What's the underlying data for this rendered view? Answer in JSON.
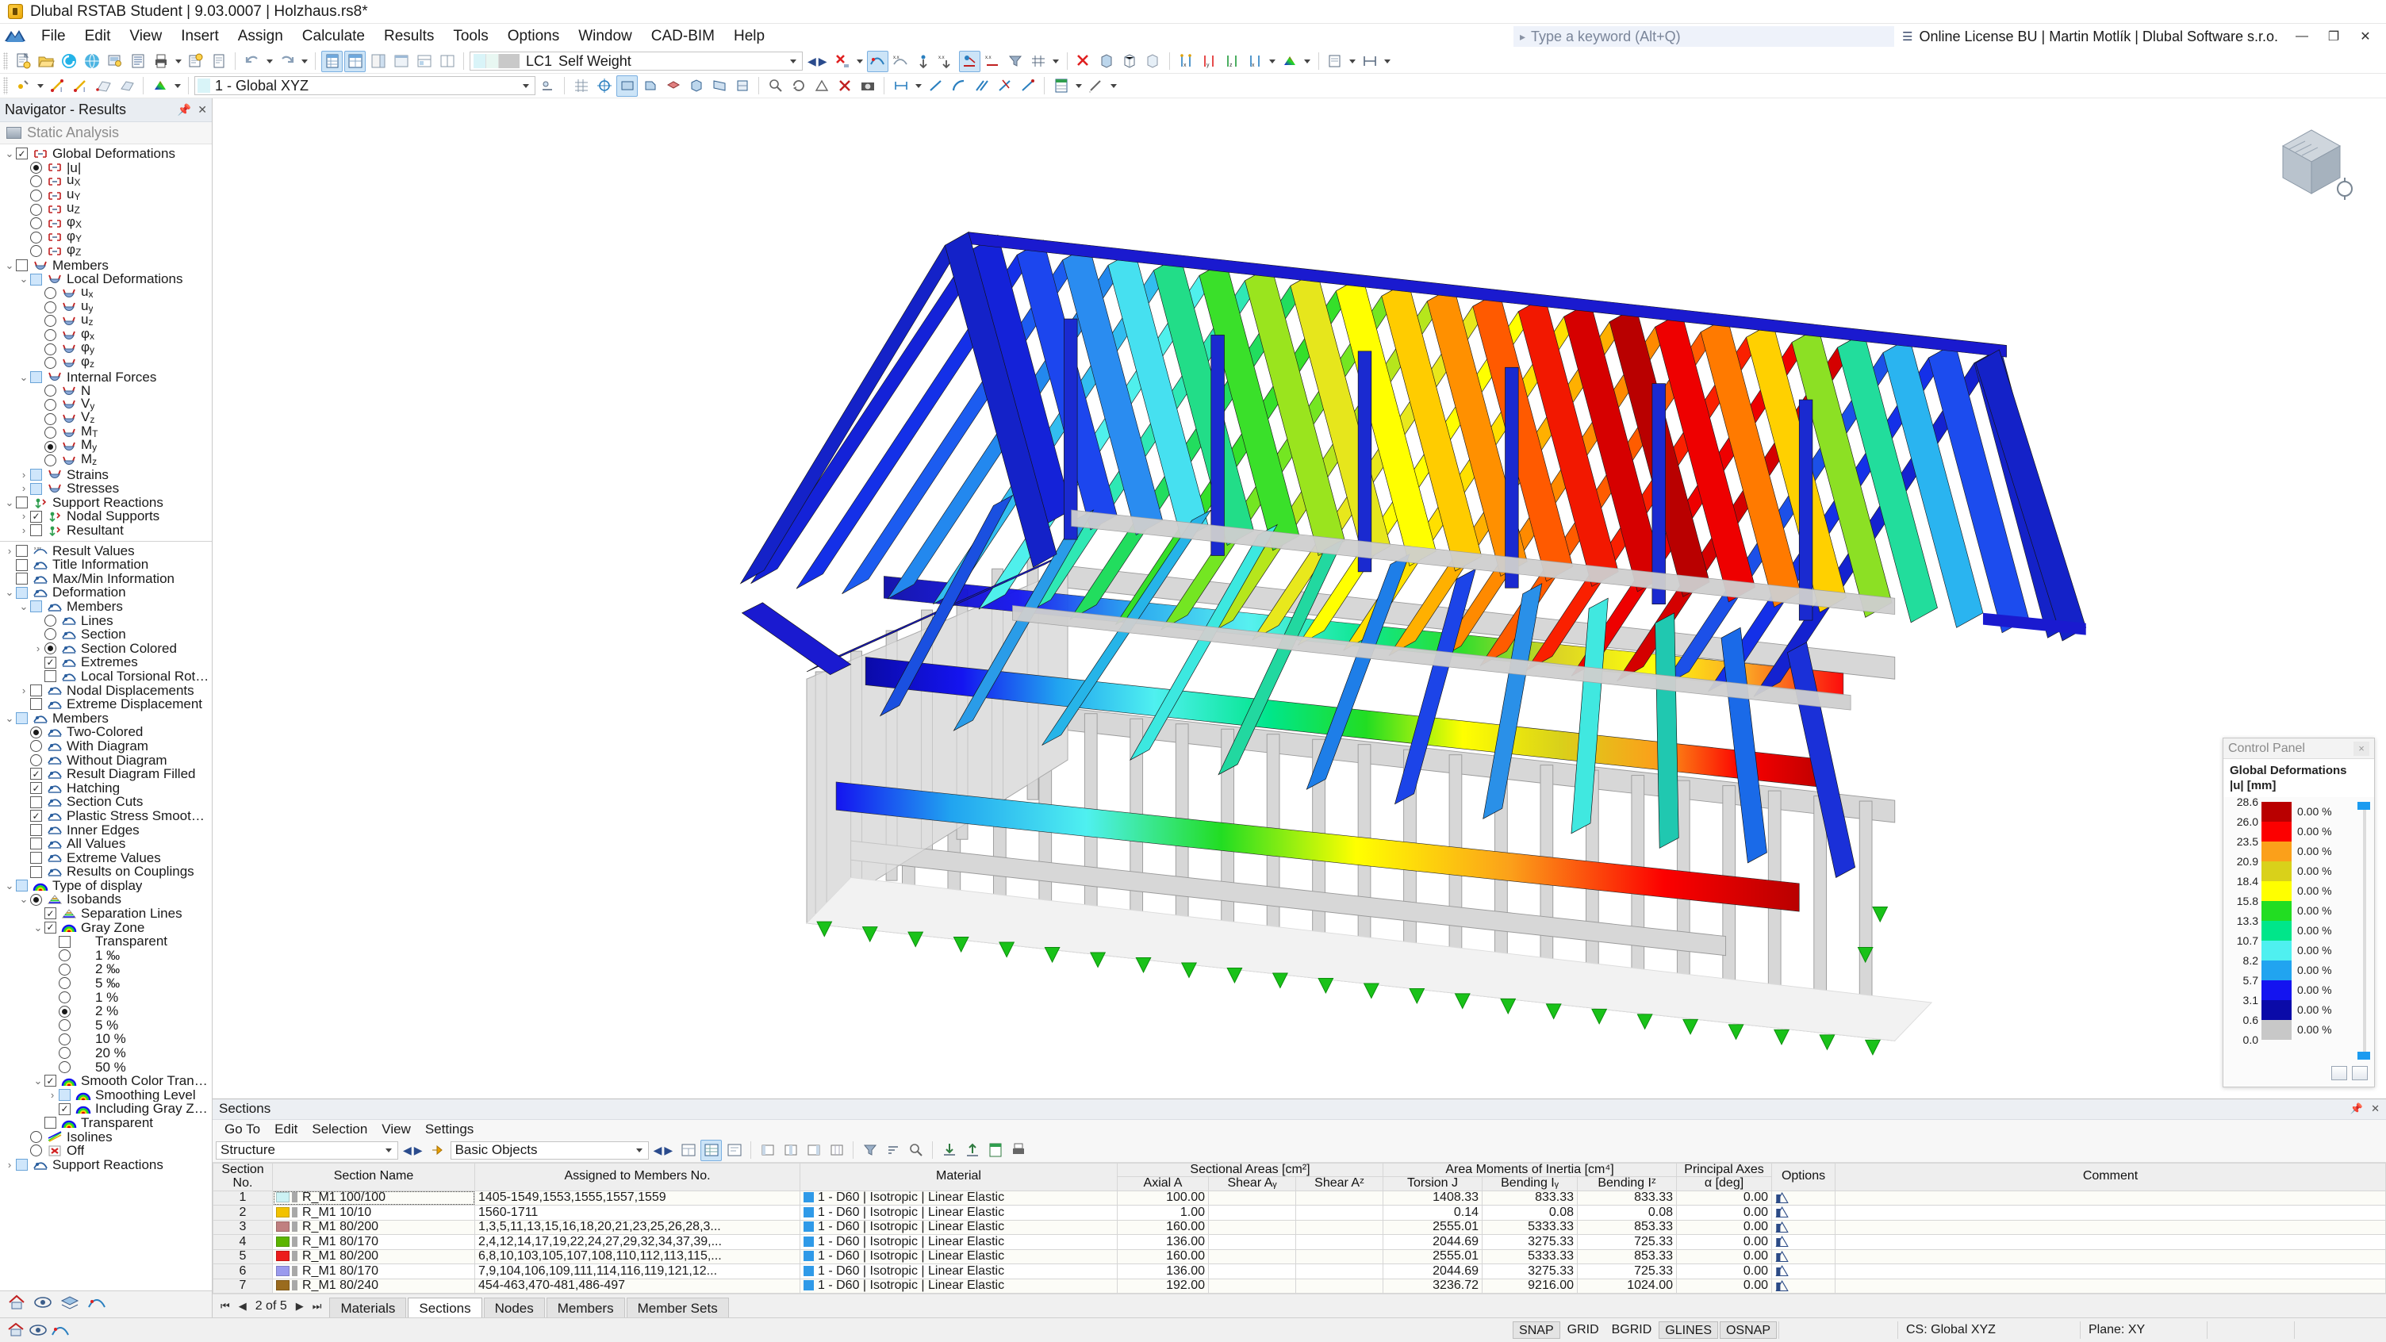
{
  "window": {
    "title": "Dlubal RSTAB Student | 9.03.0007 | Holzhaus.rs8*",
    "minimize": "—",
    "maximize": "❐",
    "close": "✕"
  },
  "menu": {
    "items": [
      "File",
      "Edit",
      "View",
      "Insert",
      "Assign",
      "Calculate",
      "Results",
      "Tools",
      "Options",
      "Window",
      "CAD-BIM",
      "Help"
    ],
    "search_placeholder": "Type a keyword (Alt+Q)",
    "license": "Online License BU | Martin Motlík | Dlubal Software s.r.o."
  },
  "toolbar": {
    "load_case_id": "LC1",
    "load_case_name": "Self Weight",
    "coordinate_system": "1 - Global XYZ"
  },
  "navigator": {
    "title": "Navigator - Results",
    "analysis": "Static Analysis",
    "tree_top": [
      {
        "ind": 0,
        "exp": "v",
        "ctrl": "chk",
        "state": "on",
        "icon": "deform-node",
        "label": "Global Deformations"
      },
      {
        "ind": 1,
        "exp": "",
        "ctrl": "rad",
        "state": "on",
        "icon": "deform-node",
        "label": "|u|"
      },
      {
        "ind": 1,
        "exp": "",
        "ctrl": "rad",
        "state": "off",
        "icon": "deform-node",
        "label": "u",
        "sub": "X"
      },
      {
        "ind": 1,
        "exp": "",
        "ctrl": "rad",
        "state": "off",
        "icon": "deform-node",
        "label": "u",
        "sub": "Y"
      },
      {
        "ind": 1,
        "exp": "",
        "ctrl": "rad",
        "state": "off",
        "icon": "deform-node",
        "label": "u",
        "sub": "Z"
      },
      {
        "ind": 1,
        "exp": "",
        "ctrl": "rad",
        "state": "off",
        "icon": "deform-node",
        "label": "φ",
        "sub": "X"
      },
      {
        "ind": 1,
        "exp": "",
        "ctrl": "rad",
        "state": "off",
        "icon": "deform-node",
        "label": "φ",
        "sub": "Y"
      },
      {
        "ind": 1,
        "exp": "",
        "ctrl": "rad",
        "state": "off",
        "icon": "deform-node",
        "label": "φ",
        "sub": "Z"
      },
      {
        "ind": 0,
        "exp": "v",
        "ctrl": "chk",
        "state": "off",
        "icon": "member",
        "label": "Members"
      },
      {
        "ind": 1,
        "exp": "v",
        "ctrl": "chk",
        "state": "part",
        "icon": "member",
        "label": "Local Deformations"
      },
      {
        "ind": 2,
        "exp": "",
        "ctrl": "rad",
        "state": "off",
        "icon": "member",
        "label": "u",
        "sub": "x"
      },
      {
        "ind": 2,
        "exp": "",
        "ctrl": "rad",
        "state": "off",
        "icon": "member",
        "label": "u",
        "sub": "y"
      },
      {
        "ind": 2,
        "exp": "",
        "ctrl": "rad",
        "state": "off",
        "icon": "member",
        "label": "u",
        "sub": "z"
      },
      {
        "ind": 2,
        "exp": "",
        "ctrl": "rad",
        "state": "off",
        "icon": "member",
        "label": "φ",
        "sub": "x"
      },
      {
        "ind": 2,
        "exp": "",
        "ctrl": "rad",
        "state": "off",
        "icon": "member",
        "label": "φ",
        "sub": "y"
      },
      {
        "ind": 2,
        "exp": "",
        "ctrl": "rad",
        "state": "off",
        "icon": "member",
        "label": "φ",
        "sub": "z"
      },
      {
        "ind": 1,
        "exp": "v",
        "ctrl": "chk",
        "state": "part",
        "icon": "member",
        "label": "Internal Forces"
      },
      {
        "ind": 2,
        "exp": "",
        "ctrl": "rad",
        "state": "off",
        "icon": "member",
        "label": "N"
      },
      {
        "ind": 2,
        "exp": "",
        "ctrl": "rad",
        "state": "off",
        "icon": "member",
        "label": "V",
        "sub": "y"
      },
      {
        "ind": 2,
        "exp": "",
        "ctrl": "rad",
        "state": "off",
        "icon": "member",
        "label": "V",
        "sub": "z"
      },
      {
        "ind": 2,
        "exp": "",
        "ctrl": "rad",
        "state": "off",
        "icon": "member",
        "label": "M",
        "sub": "T"
      },
      {
        "ind": 2,
        "exp": "",
        "ctrl": "rad",
        "state": "on",
        "icon": "member",
        "label": "M",
        "sub": "y"
      },
      {
        "ind": 2,
        "exp": "",
        "ctrl": "rad",
        "state": "off",
        "icon": "member",
        "label": "M",
        "sub": "z"
      },
      {
        "ind": 1,
        "exp": ">",
        "ctrl": "chk",
        "state": "part",
        "icon": "member",
        "label": "Strains"
      },
      {
        "ind": 1,
        "exp": ">",
        "ctrl": "chk",
        "state": "part",
        "icon": "member",
        "label": "Stresses"
      },
      {
        "ind": 0,
        "exp": "v",
        "ctrl": "chk",
        "state": "off",
        "icon": "support",
        "label": "Support Reactions"
      },
      {
        "ind": 1,
        "exp": ">",
        "ctrl": "chk",
        "state": "on",
        "icon": "support",
        "label": "Nodal Supports"
      },
      {
        "ind": 1,
        "exp": ">",
        "ctrl": "chk",
        "state": "off",
        "icon": "support",
        "label": "Resultant"
      }
    ],
    "tree_bottom": [
      {
        "ind": 0,
        "exp": ">",
        "ctrl": "chk",
        "state": "off",
        "icon": "values",
        "label": "Result Values"
      },
      {
        "ind": 0,
        "exp": "",
        "ctrl": "chk",
        "state": "off",
        "icon": "display",
        "label": "Title Information"
      },
      {
        "ind": 0,
        "exp": "",
        "ctrl": "chk",
        "state": "off",
        "icon": "display",
        "label": "Max/Min Information"
      },
      {
        "ind": 0,
        "exp": "v",
        "ctrl": "chk",
        "state": "part",
        "icon": "display",
        "label": "Deformation"
      },
      {
        "ind": 1,
        "exp": "v",
        "ctrl": "chk",
        "state": "part",
        "icon": "display",
        "label": "Members"
      },
      {
        "ind": 2,
        "exp": "",
        "ctrl": "rad",
        "state": "off",
        "icon": "display",
        "label": "Lines"
      },
      {
        "ind": 2,
        "exp": "",
        "ctrl": "rad",
        "state": "off",
        "icon": "display",
        "label": "Section"
      },
      {
        "ind": 2,
        "exp": ">",
        "ctrl": "rad",
        "state": "on",
        "icon": "display",
        "label": "Section Colored"
      },
      {
        "ind": 2,
        "exp": "",
        "ctrl": "chk",
        "state": "on",
        "icon": "display",
        "label": "Extremes"
      },
      {
        "ind": 2,
        "exp": "",
        "ctrl": "chk",
        "state": "off",
        "icon": "display",
        "label": "Local Torsional Rotations"
      },
      {
        "ind": 1,
        "exp": ">",
        "ctrl": "chk",
        "state": "off",
        "icon": "display",
        "label": "Nodal Displacements"
      },
      {
        "ind": 1,
        "exp": "",
        "ctrl": "chk",
        "state": "off",
        "icon": "display",
        "label": "Extreme Displacement"
      },
      {
        "ind": 0,
        "exp": "v",
        "ctrl": "chk",
        "state": "part",
        "icon": "display",
        "label": "Members"
      },
      {
        "ind": 1,
        "exp": "",
        "ctrl": "rad",
        "state": "on",
        "icon": "display",
        "label": "Two-Colored"
      },
      {
        "ind": 1,
        "exp": "",
        "ctrl": "rad",
        "state": "off",
        "icon": "display",
        "label": "With Diagram"
      },
      {
        "ind": 1,
        "exp": "",
        "ctrl": "rad",
        "state": "off",
        "icon": "display",
        "label": "Without Diagram"
      },
      {
        "ind": 1,
        "exp": "",
        "ctrl": "chk",
        "state": "on",
        "icon": "display",
        "label": "Result Diagram Filled"
      },
      {
        "ind": 1,
        "exp": "",
        "ctrl": "chk",
        "state": "on",
        "icon": "display",
        "label": "Hatching"
      },
      {
        "ind": 1,
        "exp": "",
        "ctrl": "chk",
        "state": "off",
        "icon": "display",
        "label": "Section Cuts"
      },
      {
        "ind": 1,
        "exp": "",
        "ctrl": "chk",
        "state": "on",
        "icon": "display",
        "label": "Plastic Stress Smoothing"
      },
      {
        "ind": 1,
        "exp": "",
        "ctrl": "chk",
        "state": "off",
        "icon": "display",
        "label": "Inner Edges"
      },
      {
        "ind": 1,
        "exp": "",
        "ctrl": "chk",
        "state": "off",
        "icon": "display",
        "label": "All Values"
      },
      {
        "ind": 1,
        "exp": "",
        "ctrl": "chk",
        "state": "off",
        "icon": "display",
        "label": "Extreme Values"
      },
      {
        "ind": 1,
        "exp": "",
        "ctrl": "chk",
        "state": "off",
        "icon": "display",
        "label": "Results on Couplings"
      },
      {
        "ind": 0,
        "exp": "v",
        "ctrl": "chk",
        "state": "part",
        "icon": "rainbow",
        "label": "Type of display"
      },
      {
        "ind": 1,
        "exp": "v",
        "ctrl": "rad",
        "state": "on",
        "icon": "isoband",
        "label": "Isobands"
      },
      {
        "ind": 2,
        "exp": "",
        "ctrl": "chk",
        "state": "on",
        "icon": "isoband",
        "label": "Separation Lines"
      },
      {
        "ind": 2,
        "exp": "v",
        "ctrl": "chk",
        "state": "on",
        "icon": "rainbow",
        "label": "Gray Zone"
      },
      {
        "ind": 3,
        "exp": "",
        "ctrl": "chk",
        "state": "off",
        "icon": "none",
        "label": "Transparent"
      },
      {
        "ind": 3,
        "exp": "",
        "ctrl": "rad",
        "state": "off",
        "icon": "none",
        "label": "1 ‰"
      },
      {
        "ind": 3,
        "exp": "",
        "ctrl": "rad",
        "state": "off",
        "icon": "none",
        "label": "2 ‰"
      },
      {
        "ind": 3,
        "exp": "",
        "ctrl": "rad",
        "state": "off",
        "icon": "none",
        "label": "5 ‰"
      },
      {
        "ind": 3,
        "exp": "",
        "ctrl": "rad",
        "state": "off",
        "icon": "none",
        "label": "1 %"
      },
      {
        "ind": 3,
        "exp": "",
        "ctrl": "rad",
        "state": "on",
        "icon": "none",
        "label": "2 %"
      },
      {
        "ind": 3,
        "exp": "",
        "ctrl": "rad",
        "state": "off",
        "icon": "none",
        "label": "5 %"
      },
      {
        "ind": 3,
        "exp": "",
        "ctrl": "rad",
        "state": "off",
        "icon": "none",
        "label": "10 %"
      },
      {
        "ind": 3,
        "exp": "",
        "ctrl": "rad",
        "state": "off",
        "icon": "none",
        "label": "20 %"
      },
      {
        "ind": 3,
        "exp": "",
        "ctrl": "rad",
        "state": "off",
        "icon": "none",
        "label": "50 %"
      },
      {
        "ind": 2,
        "exp": "v",
        "ctrl": "chk",
        "state": "on",
        "icon": "rainbow",
        "label": "Smooth Color Transition"
      },
      {
        "ind": 3,
        "exp": ">",
        "ctrl": "chk",
        "state": "part",
        "icon": "rainbow",
        "label": "Smoothing Level"
      },
      {
        "ind": 3,
        "exp": "",
        "ctrl": "chk",
        "state": "on",
        "icon": "rainbow",
        "label": "Including Gray Zone"
      },
      {
        "ind": 2,
        "exp": "",
        "ctrl": "chk",
        "state": "off",
        "icon": "rainbow",
        "label": "Transparent"
      },
      {
        "ind": 1,
        "exp": "",
        "ctrl": "rad",
        "state": "off",
        "icon": "isoline",
        "label": "Isolines"
      },
      {
        "ind": 1,
        "exp": "",
        "ctrl": "rad",
        "state": "off",
        "icon": "off",
        "label": "Off"
      },
      {
        "ind": 0,
        "exp": ">",
        "ctrl": "chk",
        "state": "part",
        "icon": "display",
        "label": "Support Reactions"
      }
    ]
  },
  "control_panel": {
    "title": "Control Panel",
    "close": "×",
    "heading_line1": "Global Deformations",
    "heading_line2": "|u| [mm]",
    "scale_values": [
      "28.6",
      "26.0",
      "23.5",
      "20.9",
      "18.4",
      "15.8",
      "13.3",
      "10.7",
      "8.2",
      "5.7",
      "3.1",
      "0.6",
      "0.0"
    ],
    "band_colors": [
      "#b90000",
      "#fc0000",
      "#fba01a",
      "#d9d11a",
      "#ffff00",
      "#22dd22",
      "#00e68a",
      "#4ff0f0",
      "#21a4f0",
      "#1414f0",
      "#0a0aa8",
      "#c8c8c8"
    ],
    "percentages": [
      "0.00 %",
      "0.00 %",
      "0.00 %",
      "0.00 %",
      "0.00 %",
      "0.00 %",
      "0.00 %",
      "0.00 %",
      "0.00 %",
      "0.00 %",
      "0.00 %",
      "0.00 %"
    ]
  },
  "sections_panel": {
    "title": "Sections",
    "menu": [
      "Go To",
      "Edit",
      "Selection",
      "View",
      "Settings"
    ],
    "filter_value": "Structure",
    "objects_value": "Basic Objects",
    "columns": {
      "section_no": "Section\nNo.",
      "section_no_l1": "Section",
      "section_no_l2": "No.",
      "section_name": "Section Name",
      "assigned": "Assigned to Members No.",
      "material": "Material",
      "group_areas": "Sectional Areas [cm²]",
      "axial": "Axial A",
      "shear_y": "Shear Aᵧ",
      "shear_z": "Shear Aᶻ",
      "group_inertia": "Area Moments of Inertia [cm⁴]",
      "torsion": "Torsion J",
      "bending_y": "Bending Iᵧ",
      "bending_z": "Bending Iᶻ",
      "group_principal": "Principal Axes",
      "alpha": "α [deg]",
      "options": "Options",
      "comment": "Comment"
    },
    "rows": [
      {
        "no": "1",
        "color": "#ccf2f4",
        "name": "R_M1 100/100",
        "assigned": "1405-1549,1553,1555,1557,1559",
        "material": "1 - D60 | Isotropic | Linear Elastic",
        "axial": "100.00",
        "shear_y": "",
        "shear_z": "",
        "torsion": "1408.33",
        "bending_y": "833.33",
        "bending_z": "833.33",
        "alpha": "0.00",
        "comment": ""
      },
      {
        "no": "2",
        "color": "#f2c200",
        "name": "R_M1 10/10",
        "assigned": "1560-1711",
        "material": "1 - D60 | Isotropic | Linear Elastic",
        "axial": "1.00",
        "shear_y": "",
        "shear_z": "",
        "torsion": "0.14",
        "bending_y": "0.08",
        "bending_z": "0.08",
        "alpha": "0.00",
        "comment": ""
      },
      {
        "no": "3",
        "color": "#c08080",
        "name": "R_M1 80/200",
        "assigned": "1,3,5,11,13,15,16,18,20,21,23,25,26,28,3...",
        "material": "1 - D60 | Isotropic | Linear Elastic",
        "axial": "160.00",
        "shear_y": "",
        "shear_z": "",
        "torsion": "2555.01",
        "bending_y": "5333.33",
        "bending_z": "853.33",
        "alpha": "0.00",
        "comment": ""
      },
      {
        "no": "4",
        "color": "#5cb500",
        "name": "R_M1 80/170",
        "assigned": "2,4,12,14,17,19,22,24,27,29,32,34,37,39,...",
        "material": "1 - D60 | Isotropic | Linear Elastic",
        "axial": "136.00",
        "shear_y": "",
        "shear_z": "",
        "torsion": "2044.69",
        "bending_y": "3275.33",
        "bending_z": "725.33",
        "alpha": "0.00",
        "comment": ""
      },
      {
        "no": "5",
        "color": "#ec1c1c",
        "name": "R_M1 80/200",
        "assigned": "6,8,10,103,105,107,108,110,112,113,115,...",
        "material": "1 - D60 | Isotropic | Linear Elastic",
        "axial": "160.00",
        "shear_y": "",
        "shear_z": "",
        "torsion": "2555.01",
        "bending_y": "5333.33",
        "bending_z": "853.33",
        "alpha": "0.00",
        "comment": ""
      },
      {
        "no": "6",
        "color": "#9a9aee",
        "name": "R_M1 80/170",
        "assigned": "7,9,104,106,109,111,114,116,119,121,12...",
        "material": "1 - D60 | Isotropic | Linear Elastic",
        "axial": "136.00",
        "shear_y": "",
        "shear_z": "",
        "torsion": "2044.69",
        "bending_y": "3275.33",
        "bending_z": "725.33",
        "alpha": "0.00",
        "comment": ""
      },
      {
        "no": "7",
        "color": "#9a6b1e",
        "name": "R_M1 80/240",
        "assigned": "454-463,470-481,486-497",
        "material": "1 - D60 | Isotropic | Linear Elastic",
        "axial": "192.00",
        "shear_y": "",
        "shear_z": "",
        "torsion": "3236.72",
        "bending_y": "9216.00",
        "bending_z": "1024.00",
        "alpha": "0.00",
        "comment": ""
      }
    ],
    "pagination": "2 of 5",
    "tabs": [
      {
        "label": "Materials",
        "active": false
      },
      {
        "label": "Sections",
        "active": true
      },
      {
        "label": "Nodes",
        "active": false
      },
      {
        "label": "Members",
        "active": false
      },
      {
        "label": "Member Sets",
        "active": false
      }
    ]
  },
  "statusbar": {
    "toggles": [
      "SNAP",
      "GRID",
      "BGRID",
      "GLINES",
      "OSNAP"
    ],
    "toggles_on": [
      "SNAP",
      "GLINES",
      "OSNAP"
    ],
    "cs": "CS: Global XYZ",
    "plane": "Plane: XY"
  },
  "chart_data": {
    "type": "heatmap",
    "title": "Global Deformations |u| [mm]",
    "legend_position": "bottom-right",
    "scale": [
      28.6,
      26.0,
      23.5,
      20.9,
      18.4,
      15.8,
      13.3,
      10.7,
      8.2,
      5.7,
      3.1,
      0.6,
      0.0
    ],
    "band_colors": [
      "#b90000",
      "#fc0000",
      "#fba01a",
      "#d9d11a",
      "#ffff00",
      "#22dd22",
      "#00e68a",
      "#4ff0f0",
      "#21a4f0",
      "#1414f0",
      "#0a0aa8",
      "#c8c8c8"
    ],
    "band_percentages": [
      0,
      0,
      0,
      0,
      0,
      0,
      0,
      0,
      0,
      0,
      0,
      0
    ],
    "units": "mm",
    "ylabel": "|u| [mm]"
  }
}
